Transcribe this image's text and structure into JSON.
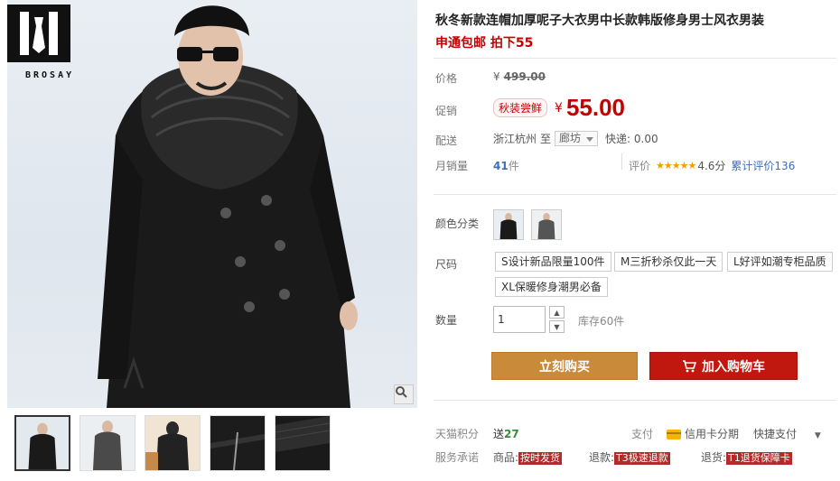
{
  "brand": {
    "logo_text": "BROSAY"
  },
  "product": {
    "title": "秋冬新款连帽加厚呢子大衣男中长款韩版修身男士风衣男装",
    "subtitle": "申通包邮 拍下55"
  },
  "price": {
    "label": "价格",
    "currency": "¥",
    "original": "499.00"
  },
  "promo": {
    "label": "促销",
    "tag": "秋装尝鲜",
    "currency": "¥",
    "price": "55.00"
  },
  "delivery": {
    "label": "配送",
    "from": "浙江杭州",
    "to_word": "至",
    "to_city": "廊坊",
    "express": "快递: 0.00"
  },
  "sales": {
    "label": "月销量",
    "count": "41",
    "unit": "件",
    "rating_label": "评价",
    "stars": "★★★★★",
    "score": "4.6分",
    "total_reviews": "累计评价136"
  },
  "color": {
    "label": "颜色分类"
  },
  "size": {
    "label": "尺码",
    "options": [
      "S设计新品限量100件",
      "M三折秒杀仅此一天",
      "L好评如潮专柜品质",
      "XL保暖修身潮男必备"
    ]
  },
  "quantity": {
    "label": "数量",
    "value": "1",
    "stock": "库存60件"
  },
  "actions": {
    "buy_now": "立刻购买",
    "add_to_cart": "加入购物车"
  },
  "points": {
    "label": "天猫积分",
    "text": "送",
    "value": "27",
    "pay_label": "支付",
    "credit": "信用卡分期",
    "quick": "快捷支付"
  },
  "service": {
    "label": "服务承诺",
    "item1_label": "商品:",
    "item1_badge": "按时发货",
    "item2_label": "退款:",
    "item2_badge": "T3极速退款",
    "item3_label": "退货:",
    "item3_badge": "T1退货保障卡"
  },
  "colors": {
    "price_red": "#c40000",
    "buy_btn": "#c98a3a",
    "cart_btn": "#c0170f"
  }
}
